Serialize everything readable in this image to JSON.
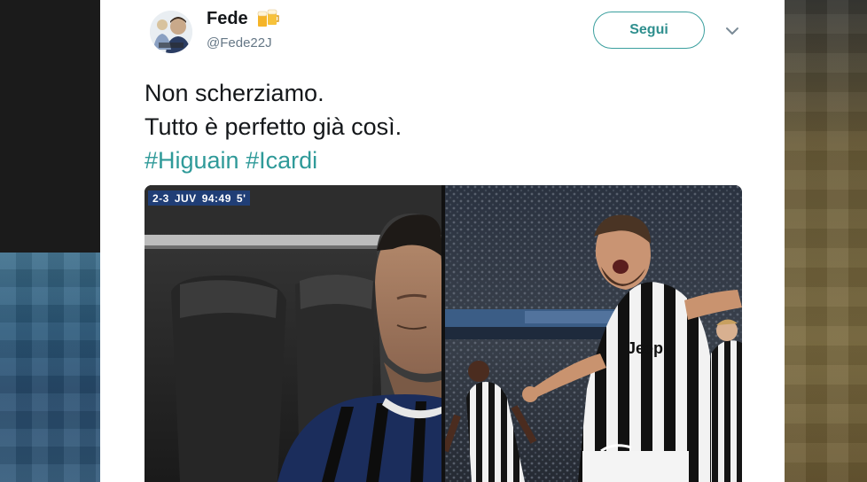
{
  "tweet": {
    "author_name": "Fede",
    "author_handle": "@Fede22J",
    "follow_label": "Segui",
    "text_lines": [
      "Non scherziamo.",
      "Tutto è perfetto già così."
    ],
    "hashtags": [
      "#Higuain",
      "#Icardi"
    ]
  },
  "media": {
    "scorebug": {
      "score": "2-3",
      "team": "JUV",
      "clock": "94:49",
      "added": "5'"
    },
    "jersey_text": "Jeep"
  },
  "icons": [
    "avatar-image",
    "beer-emoji-icon",
    "chevron-down-icon"
  ],
  "colors": {
    "accent": "#2f9a99",
    "text": "#14171a",
    "muted": "#657786",
    "scorebug": "#203e76"
  }
}
